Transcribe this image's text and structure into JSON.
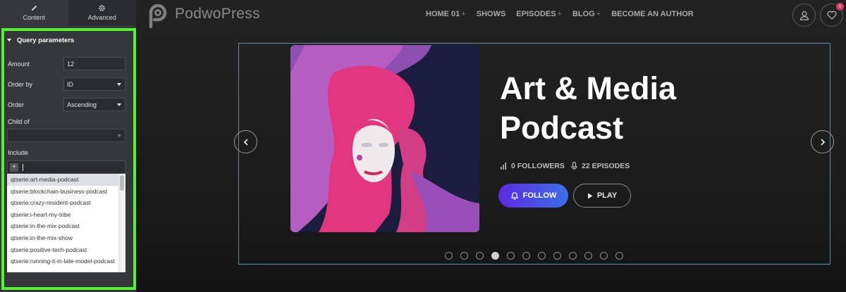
{
  "panel": {
    "tabs": [
      {
        "label": "Content",
        "icon": "pencil-icon"
      },
      {
        "label": "Advanced",
        "icon": "gear-icon"
      }
    ],
    "section_title": "Query parameters",
    "amount": {
      "label": "Amount",
      "value": "12"
    },
    "order_by": {
      "label": "Order by",
      "value": "ID"
    },
    "order": {
      "label": "Order",
      "value": "Ascending"
    },
    "child_of": {
      "label": "Child of",
      "value": ""
    },
    "include": {
      "label": "Include",
      "plus": "+",
      "options": [
        "qtserie:art-media-podcast",
        "qtserie:blockchain-business-podcast",
        "qtserie:crazy-resident-podcast",
        "qtserie:i-heart-my-tribe",
        "qtserie:in-the-mix-podcast",
        "qtserie:in-the-mix-show",
        "qtserie:positive-tech-podcast",
        "qtserie:running-it-in-late-model-podcast"
      ]
    },
    "highlight_color": "#55f22f"
  },
  "site": {
    "logo": "PodwoPress",
    "nav": [
      {
        "label": "HOME 01",
        "has_sub": true
      },
      {
        "label": "SHOWS",
        "has_sub": false
      },
      {
        "label": "EPISODES",
        "has_sub": true
      },
      {
        "label": "BLOG",
        "has_sub": true
      },
      {
        "label": "BECOME AN AUTHOR",
        "has_sub": false
      }
    ],
    "nav_plus": "+",
    "cart_count": "0",
    "hero": {
      "title_line1": "Art & Media",
      "title_line2": "Podcast",
      "followers": "0 FOLLOWERS",
      "episodes": "22 EPISODES",
      "follow_label": "FOLLOW",
      "play_label": "PLAY",
      "slides_total": 12,
      "active_slide": 4
    },
    "accent_gradient": [
      "#5a2be0",
      "#3b6fe8"
    ]
  }
}
